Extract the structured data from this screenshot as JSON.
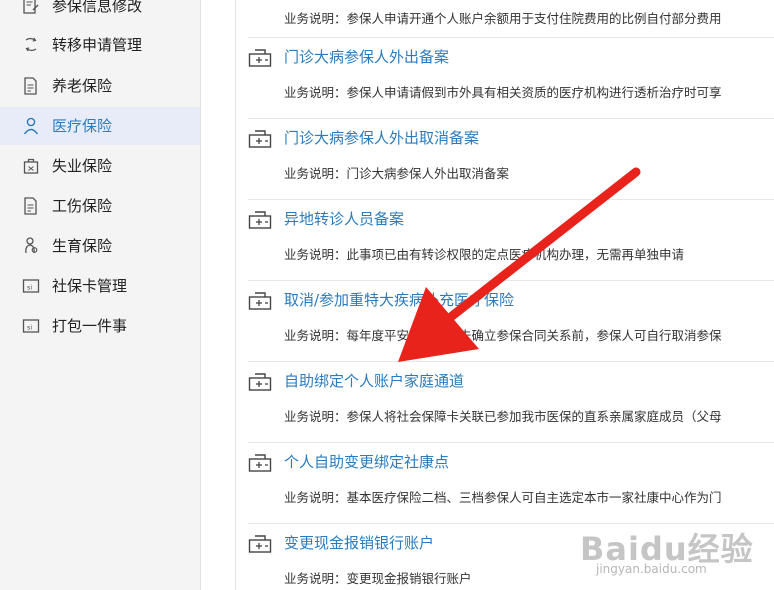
{
  "sidebar": {
    "items": [
      {
        "label": "参保信息修改",
        "icon": "edit-doc-icon",
        "active": false
      },
      {
        "label": "转移申请管理",
        "icon": "transfer-icon",
        "active": false
      },
      {
        "label": "养老保险",
        "icon": "doc-icon",
        "active": false
      },
      {
        "label": "医疗保险",
        "icon": "person-icon",
        "active": true
      },
      {
        "label": "失业保险",
        "icon": "briefcase-icon",
        "active": false
      },
      {
        "label": "工伤保险",
        "icon": "doc-icon",
        "active": false
      },
      {
        "label": "生育保险",
        "icon": "baby-icon",
        "active": false
      },
      {
        "label": "社保卡管理",
        "icon": "card-icon",
        "active": false
      },
      {
        "label": "打包一件事",
        "icon": "card-icon",
        "active": false
      }
    ]
  },
  "services": [
    {
      "title": "",
      "desc": "业务说明：参保人申请开通个人账户余额用于支付住院费用的比例自付部分费用"
    },
    {
      "title": "门诊大病参保人外出备案",
      "desc": "业务说明：参保人申请请假到市外具有相关资质的医疗机构进行透析治疗时可享"
    },
    {
      "title": "门诊大病参保人外出取消备案",
      "desc": "业务说明：门诊大病参保人外出取消备案"
    },
    {
      "title": "异地转诊人员备案",
      "desc": "业务说明：此事项已由有转诊权限的定点医疗机构办理，无需再单独申请"
    },
    {
      "title": "取消/参加重特大疾病补充医疗保险",
      "desc": "业务说明：每年度平安重疾保险未确立参保合同关系前，参保人可自行取消参保"
    },
    {
      "title": "自助绑定个人账户家庭通道",
      "desc": "业务说明：参保人将社会保障卡关联已参加我市医保的直系亲属家庭成员（父母"
    },
    {
      "title": "个人自助变更绑定社康点",
      "desc": "业务说明：基本医疗保险二档、三档参保人可自主选定本市一家社康中心作为门"
    },
    {
      "title": "变更现金报销银行账户",
      "desc": "业务说明：变更现金报销银行账户"
    }
  ],
  "service_icon": "service-printer-icon",
  "annotation": {
    "type": "red-arrow",
    "color": "#e8231c"
  },
  "watermark": {
    "brand": "Baidu经验",
    "site": "jingyan.baidu.com"
  }
}
